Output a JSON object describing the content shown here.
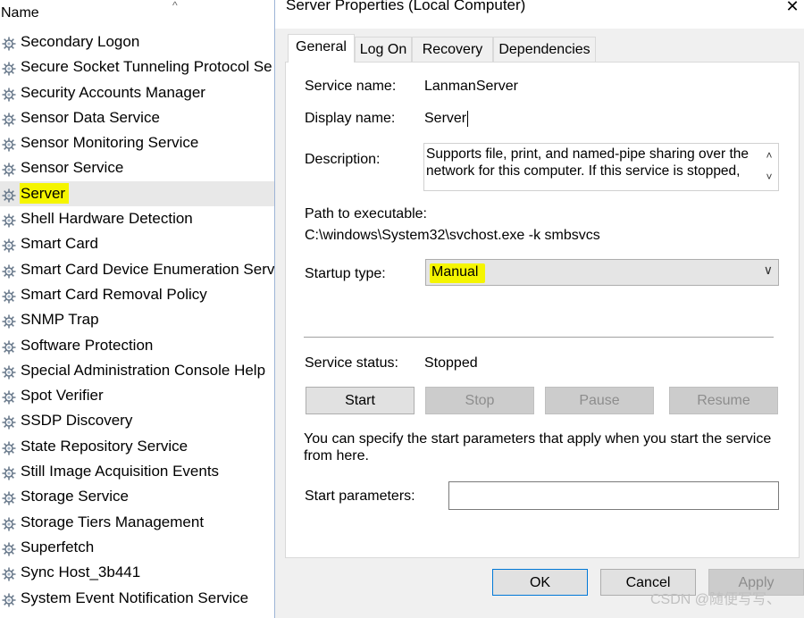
{
  "services_list": {
    "column_header": "Name",
    "sort_indicator": "^",
    "items": [
      {
        "label": "Secondary Logon",
        "selected": false
      },
      {
        "label": "Secure Socket Tunneling Protocol Se",
        "selected": false
      },
      {
        "label": "Security Accounts Manager",
        "selected": false
      },
      {
        "label": "Sensor Data Service",
        "selected": false
      },
      {
        "label": "Sensor Monitoring Service",
        "selected": false
      },
      {
        "label": "Sensor Service",
        "selected": false
      },
      {
        "label": "Server",
        "selected": true
      },
      {
        "label": "Shell Hardware Detection",
        "selected": false
      },
      {
        "label": "Smart Card",
        "selected": false
      },
      {
        "label": "Smart Card Device Enumeration Serv",
        "selected": false
      },
      {
        "label": "Smart Card Removal Policy",
        "selected": false
      },
      {
        "label": "SNMP Trap",
        "selected": false
      },
      {
        "label": "Software Protection",
        "selected": false
      },
      {
        "label": "Special Administration Console Help",
        "selected": false
      },
      {
        "label": "Spot Verifier",
        "selected": false
      },
      {
        "label": "SSDP Discovery",
        "selected": false
      },
      {
        "label": "State Repository Service",
        "selected": false
      },
      {
        "label": "Still Image Acquisition Events",
        "selected": false
      },
      {
        "label": "Storage Service",
        "selected": false
      },
      {
        "label": "Storage Tiers Management",
        "selected": false
      },
      {
        "label": "Superfetch",
        "selected": false
      },
      {
        "label": "Sync Host_3b441",
        "selected": false
      },
      {
        "label": "System Event Notification Service",
        "selected": false
      }
    ],
    "icon": "gear-icon"
  },
  "dialog": {
    "title": "Server Properties (Local Computer)",
    "close_glyph": "✕",
    "tabs": [
      {
        "label": "General",
        "active": true
      },
      {
        "label": "Log On",
        "active": false
      },
      {
        "label": "Recovery",
        "active": false
      },
      {
        "label": "Dependencies",
        "active": false
      }
    ],
    "general": {
      "service_name_label": "Service name:",
      "service_name_value": "LanmanServer",
      "display_name_label": "Display name:",
      "display_name_value": "Server",
      "description_label": "Description:",
      "description_value": "Supports file, print, and named-pipe sharing over the network for this computer. If this service is stopped,",
      "path_label": "Path to executable:",
      "path_value": "C:\\windows\\System32\\svchost.exe -k smbsvcs",
      "startup_type_label": "Startup type:",
      "startup_type_value": "Manual",
      "service_status_label": "Service status:",
      "service_status_value": "Stopped",
      "buttons": {
        "start": "Start",
        "stop": "Stop",
        "pause": "Pause",
        "resume": "Resume"
      },
      "params_note": "You can specify the start parameters that apply when you start the service from here.",
      "start_params_label": "Start parameters:",
      "start_params_value": ""
    },
    "footer": {
      "ok": "OK",
      "cancel": "Cancel",
      "apply": "Apply"
    }
  },
  "watermark": "CSDN @随便写写、",
  "colors": {
    "highlight": "#f5f500",
    "ok_border": "#0078d7",
    "dialog_bg": "#f0f0f0"
  }
}
